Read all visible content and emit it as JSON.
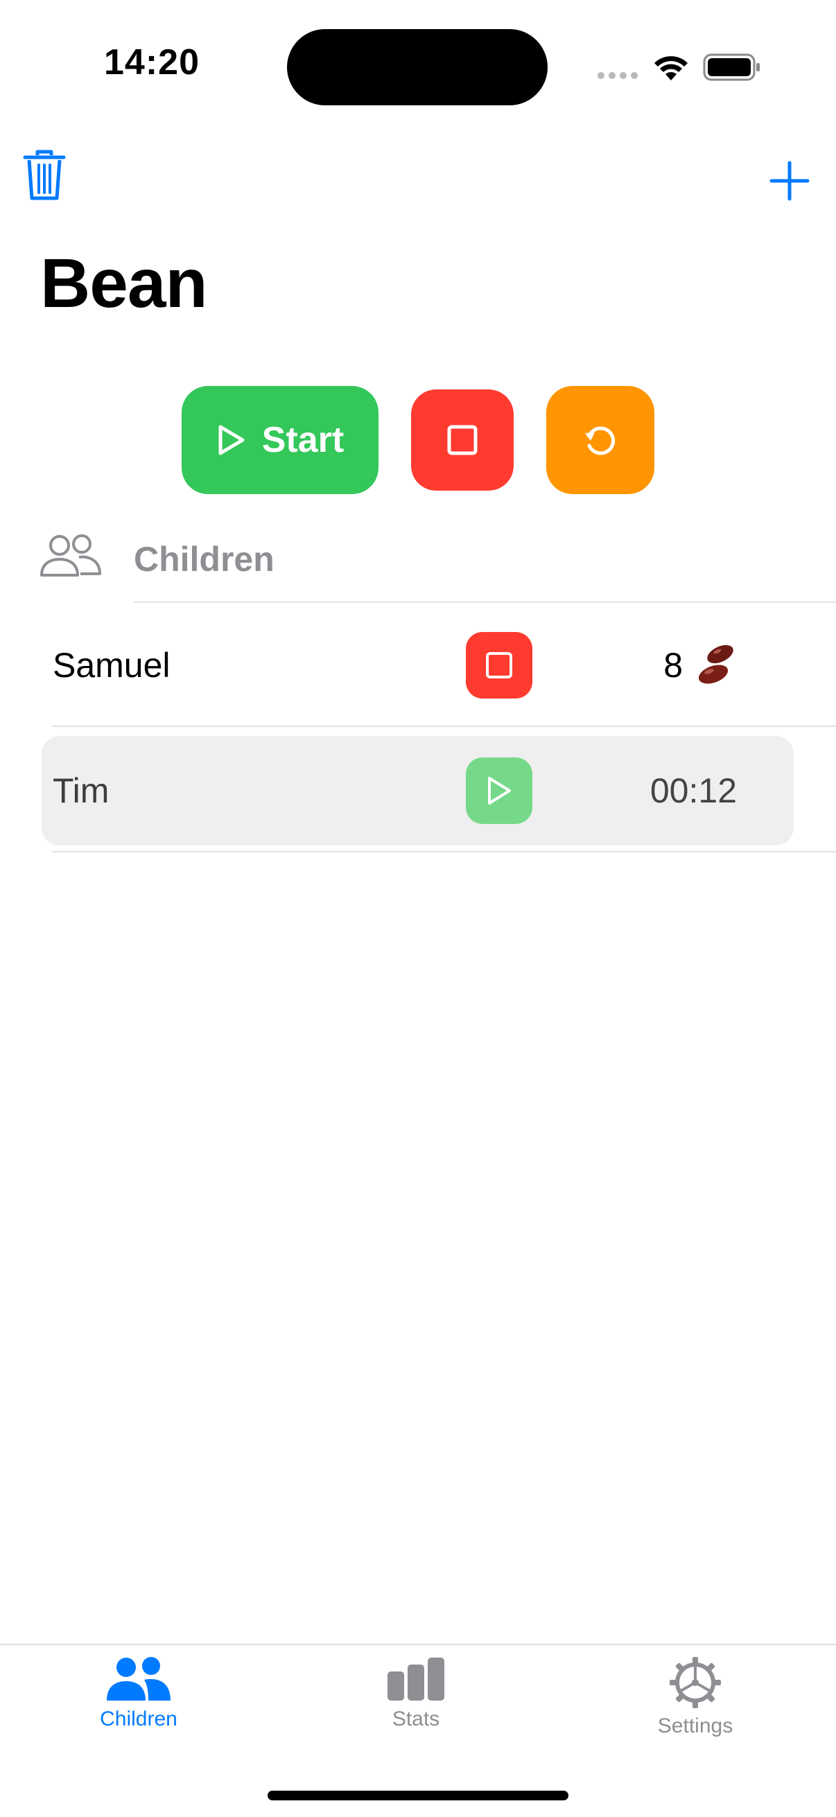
{
  "status_bar": {
    "time": "14:20"
  },
  "nav": {
    "left_icon": "trash-icon",
    "right_icon": "plus-icon"
  },
  "title": "Bean",
  "controls": {
    "start_label": "Start",
    "stop_icon": "stop-square-icon",
    "reset_icon": "reset-arrow-icon"
  },
  "section": {
    "icon": "people-icon",
    "title": "Children"
  },
  "children": [
    {
      "name": "Samuel",
      "button": "stop",
      "value": "8",
      "value_icon": "bean-icon",
      "active": false
    },
    {
      "name": "Tim",
      "button": "play",
      "value": "00:12",
      "active": true
    }
  ],
  "tabs": [
    {
      "label": "Children",
      "icon": "people-fill-icon",
      "active": true
    },
    {
      "label": "Stats",
      "icon": "bar-chart-icon",
      "active": false
    },
    {
      "label": "Settings",
      "icon": "gear-icon",
      "active": false
    }
  ],
  "colors": {
    "accent": "#007aff",
    "start": "#34c759",
    "stop": "#ff3b30",
    "reset": "#ff9500",
    "secondary_text": "#8e8e93"
  }
}
